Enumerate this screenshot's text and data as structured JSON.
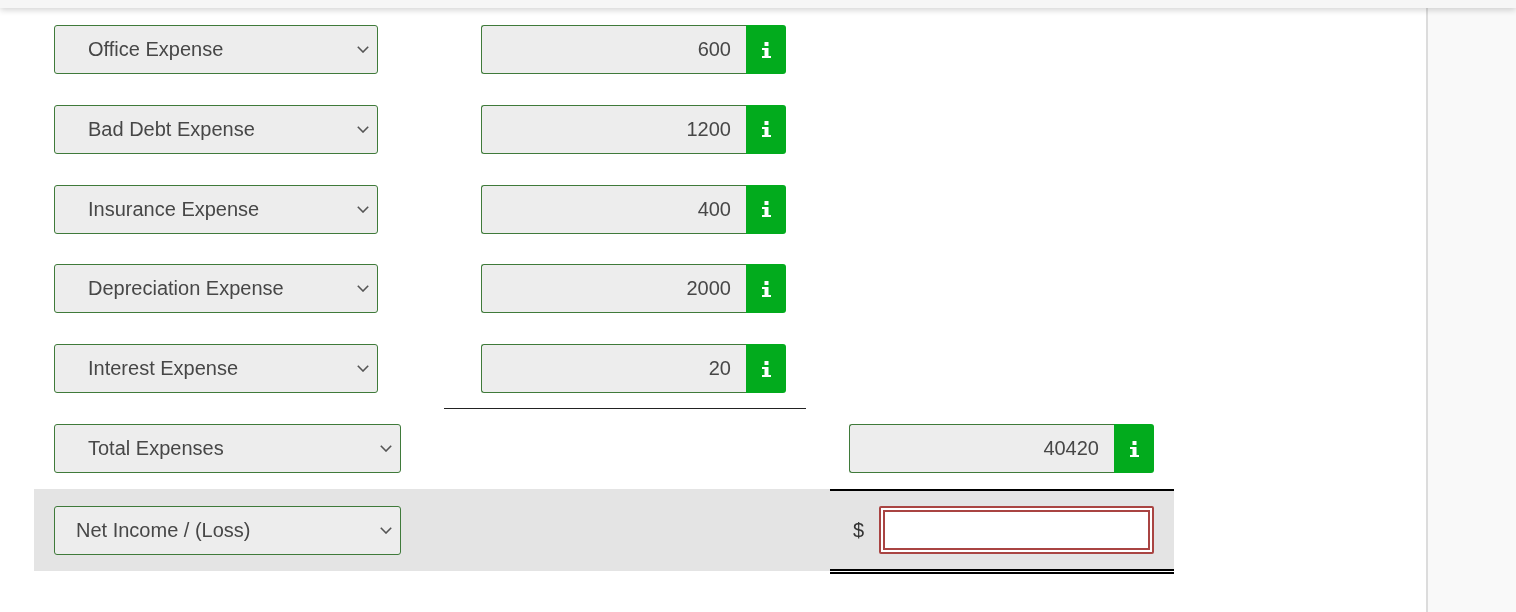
{
  "expense_rows": [
    {
      "account": "Office Expense",
      "amount": "600"
    },
    {
      "account": "Bad Debt Expense",
      "amount": "1200"
    },
    {
      "account": "Insurance Expense",
      "amount": "400"
    },
    {
      "account": "Depreciation Expense",
      "amount": "2000"
    },
    {
      "account": "Interest Expense",
      "amount": "20"
    }
  ],
  "total_row": {
    "account": "Total Expenses",
    "amount": "40420"
  },
  "net_income_row": {
    "account": "Net Income / (Loss)",
    "currency": "$",
    "answer": {
      "invalid": true
    }
  }
}
